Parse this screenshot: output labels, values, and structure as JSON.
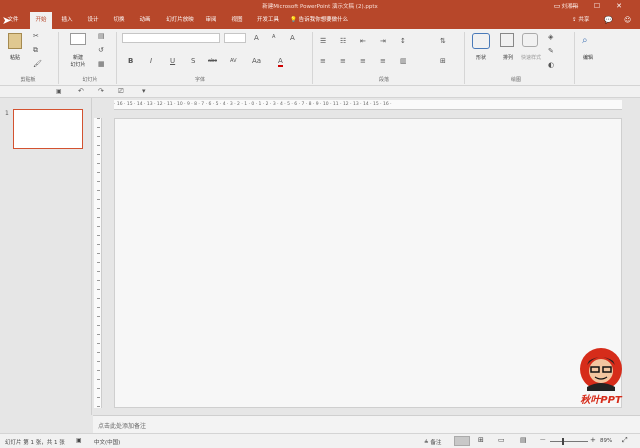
{
  "window": {
    "title": "新建Microsoft PowerPoint 演示文稿 (2).pptx",
    "user": "刘湘阳",
    "controls": {
      "minimize": "—",
      "maximize": "☐",
      "close": "✕",
      "ribbon_display": "▭"
    }
  },
  "tabs": [
    {
      "label": "文件"
    },
    {
      "label": "开始",
      "active": true
    },
    {
      "label": "插入"
    },
    {
      "label": "设计"
    },
    {
      "label": "切换"
    },
    {
      "label": "动画"
    },
    {
      "label": "幻灯片放映"
    },
    {
      "label": "审阅"
    },
    {
      "label": "视图"
    },
    {
      "label": "开发工具"
    }
  ],
  "tell_me": "告诉我你想要做什么",
  "share": "共享",
  "ribbon": {
    "clipboard": {
      "label": "剪贴板",
      "paste": "粘贴"
    },
    "slides": {
      "label": "幻灯片",
      "new_slide": "新建",
      "new_slide2": "幻灯片"
    },
    "font": {
      "label": "字体",
      "font_name": "",
      "font_size": "",
      "bold": "B",
      "italic": "I",
      "underline": "U",
      "shadow": "S",
      "strike": "abc",
      "spacing": "AV",
      "case": "Aa",
      "grow": "A",
      "shrink": "A",
      "clear": "A",
      "color": "A"
    },
    "paragraph": {
      "label": "段落"
    },
    "drawing": {
      "label": "绘图",
      "shapes": "形状",
      "arrange": "排列",
      "quick_styles": "快速样式"
    },
    "editing": {
      "label": "编辑"
    }
  },
  "qat": {
    "undo": "↶",
    "redo": "↷",
    "save": "💾"
  },
  "thumbnails": [
    {
      "number": "1"
    }
  ],
  "ruler": {
    "h_ticks": "· 16 · 15 · 14 · 13 · 12 · 11 · 10 · 9 · 8 · 7 · 6 · 5 · 4 · 3 · 2 · 1 · 0 · 1 · 2 · 3 · 4 · 5 · 6 · 7 · 8 · 9 · 10 · 11 · 12 · 13 · 14 · 15 · 16 ·"
  },
  "notes": {
    "placeholder": "点击此处添加备注"
  },
  "status": {
    "slide_info": "幻灯片 第 1 张，共 1 张",
    "language": "中文(中国)",
    "notes_btn": "备注",
    "zoom": "89%"
  },
  "logo": {
    "text": "秋叶PPT"
  },
  "colors": {
    "accent": "#b7472a",
    "slide_border": "#d35230"
  }
}
